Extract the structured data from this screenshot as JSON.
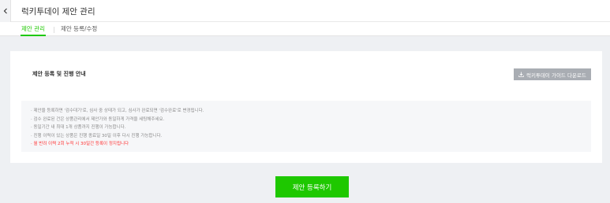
{
  "header": {
    "title": "럭키투데이 제안 관리",
    "back_icon": "chevron-left-icon"
  },
  "tabs": [
    {
      "label": "제안 관리",
      "active": true
    },
    {
      "label": "제안 등록/수정",
      "active": false
    }
  ],
  "card": {
    "title": "제안 등록 및 진행 안내",
    "guide_button": {
      "label": "럭키투데이 가이드 다운로드",
      "icon": "download-icon"
    }
  },
  "notice": {
    "items": [
      "· 제안을 등록하면 '검수대기'로, 심사 중 상태가 되고, 심사가 완료되면 '검수완료'로 변경됩니다.",
      "· 검수 완료된 건은 상품관리에서 제안가와 동일하게 가격을 세팅해주세요.",
      "· 동일기간 내 최대 1개 상품까지 진행이 가능합니다.",
      "· 진행 이력이 있는 상품은 진행 종료일 30일 이후 다시 진행 가능합니다.",
      "· 월 반려 이력 2회 누적 시 30일간 등록이 정지됩니다"
    ],
    "warning_color": "#ff3333"
  },
  "submit_button": {
    "label": "제안 등록하기"
  },
  "colors": {
    "accent": "#1ec800",
    "guide_button": "#a9adb3"
  }
}
